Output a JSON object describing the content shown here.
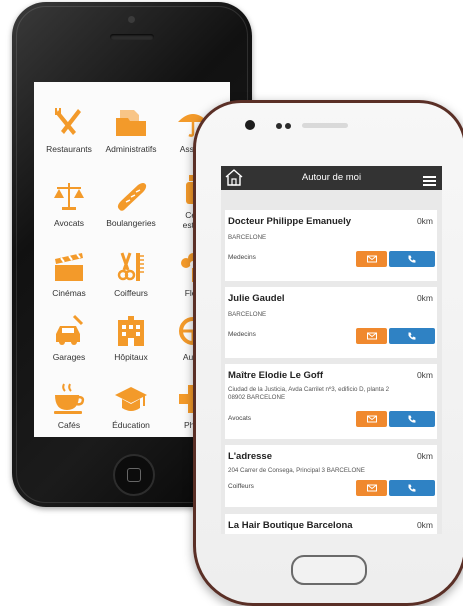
{
  "iphone_app": {
    "categories": [
      {
        "label": "Restaurants",
        "icon": "fork-knife-icon"
      },
      {
        "label": "Administratifs",
        "icon": "folder-icon"
      },
      {
        "label": "Assura",
        "icon": "umbrella-icon"
      },
      {
        "label": "Avocats",
        "icon": "scales-icon"
      },
      {
        "label": "Boulangeries",
        "icon": "baguette-icon"
      },
      {
        "label": "Cen",
        "icon": "bottle-icon"
      },
      {
        "label": "esthé",
        "icon": ""
      },
      {
        "label": "Cinémas",
        "icon": "clapperboard-icon"
      },
      {
        "label": "Coiffeurs",
        "icon": "scissors-comb-icon"
      },
      {
        "label": "Fleu",
        "icon": "flower-icon"
      },
      {
        "label": "Garages",
        "icon": "car-wrench-icon"
      },
      {
        "label": "Hôpitaux",
        "icon": "hospital-icon"
      },
      {
        "label": "Auto-",
        "icon": "steering-wheel-icon"
      },
      {
        "label": "Cafés",
        "icon": "coffee-cup-icon"
      },
      {
        "label": "Éducation",
        "icon": "graduation-cap-icon"
      },
      {
        "label": "Phar",
        "icon": "pharmacy-cross-icon"
      }
    ]
  },
  "galaxy_app": {
    "title": "Autour de moi",
    "home_icon": "home-icon",
    "menu_icon": "hamburger-menu-icon",
    "mail_icon": "envelope-icon",
    "call_icon": "phone-icon",
    "listings": [
      {
        "name": "Docteur Philippe Emanuely",
        "distance": "0km",
        "address_lines": [
          "BARCELONE"
        ],
        "category": "Medecins"
      },
      {
        "name": "Julie Gaudel",
        "distance": "0km",
        "address_lines": [
          "BARCELONE"
        ],
        "category": "Medecins"
      },
      {
        "name": "Maître Elodie Le Goff",
        "distance": "0km",
        "address_lines": [
          "Ciudad de la Justicia, Avda Carrilet nº3, edificio D, planta 2",
          "08902 BARCELONE"
        ],
        "category": "Avocats"
      },
      {
        "name": "L'adresse",
        "distance": "0km",
        "address_lines": [
          "204 Carrer de Consega, Principal 3 BARCELONE"
        ],
        "category": "Coiffeurs"
      },
      {
        "name": "La Hair Boutique Barcelona",
        "distance": "0km",
        "address_lines": [],
        "category": ""
      }
    ]
  },
  "colors": {
    "accent_orange": "#f0892e",
    "accent_blue": "#2f82c4",
    "header_dark": "#333333",
    "icon_orange": "#f39a2a"
  }
}
